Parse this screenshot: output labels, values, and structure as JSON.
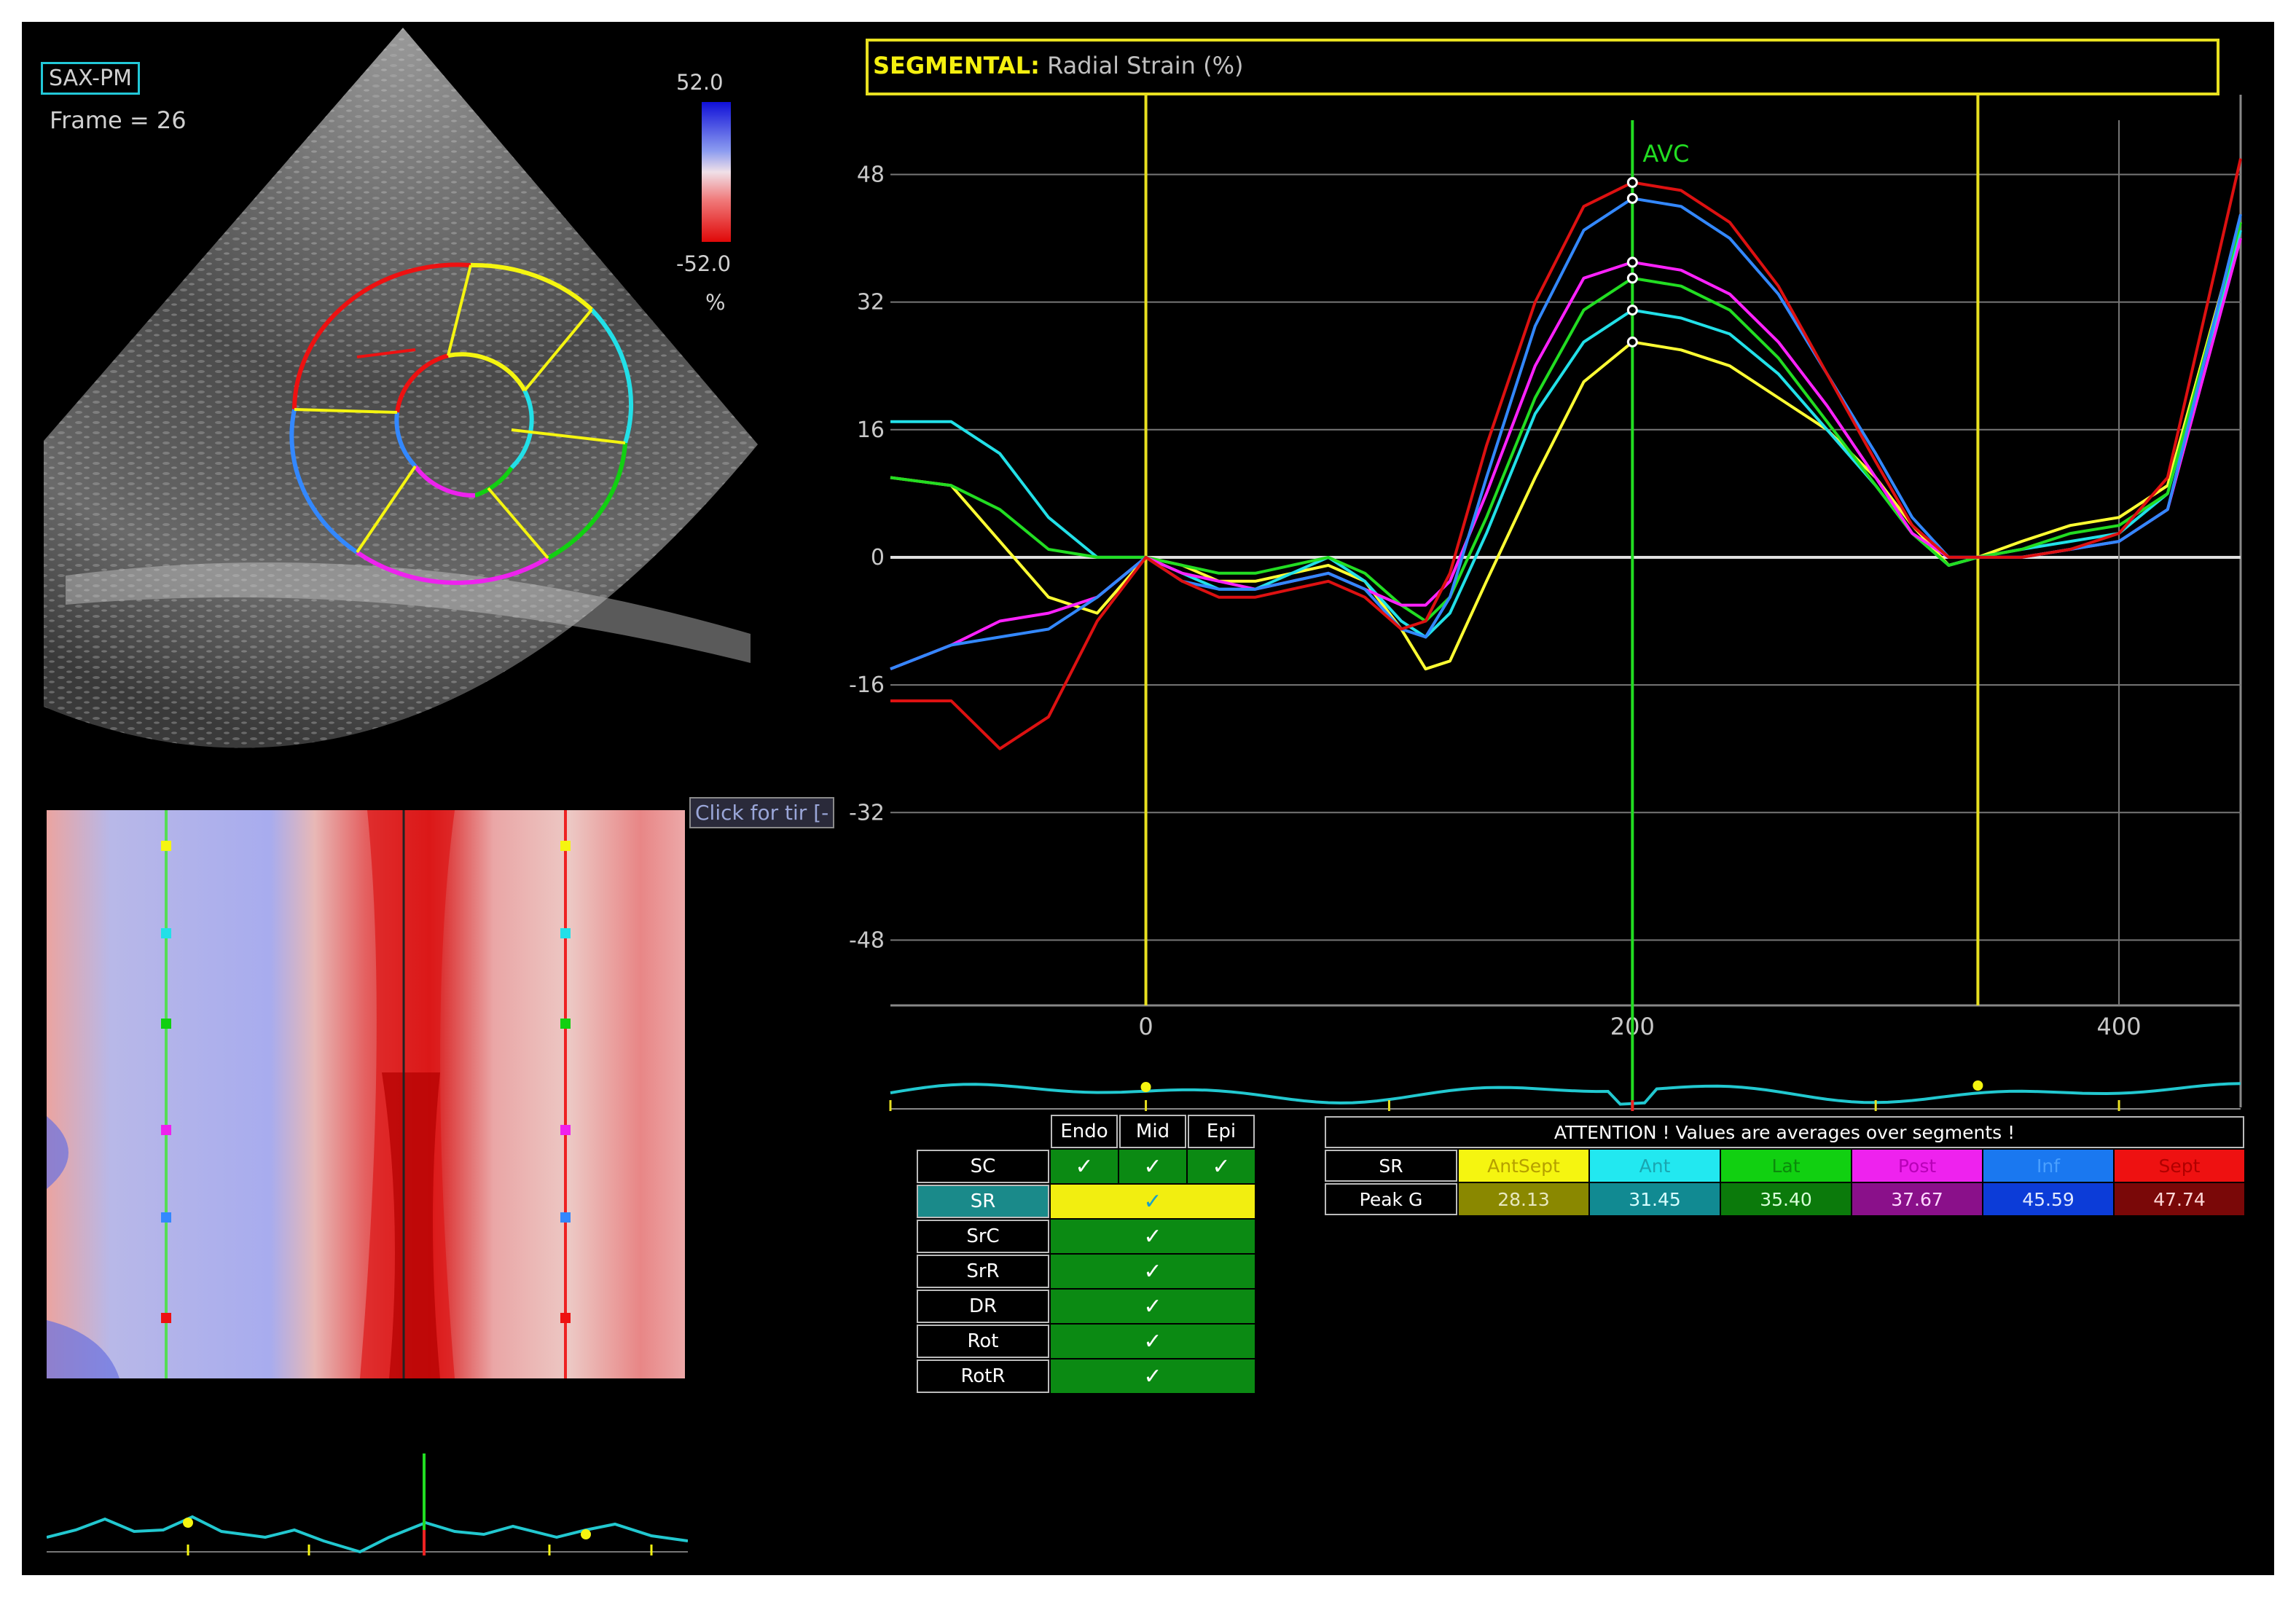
{
  "image_panel": {
    "view_label": "SAX-PM",
    "frame_text": "Frame = 26",
    "scale_max": "52.0",
    "scale_min": "-52.0",
    "scale_unit": "%"
  },
  "tooltip": "Click for tir [-",
  "chart_data": {
    "type": "line",
    "title_prefix": "SEGMENTAL:",
    "title": "Radial Strain (%)",
    "xlim": [
      -105,
      450
    ],
    "ylim": [
      -56,
      58
    ],
    "yticks": [
      48,
      32,
      16,
      0,
      -16,
      -32,
      -48
    ],
    "xticks": [
      0,
      200,
      400
    ],
    "marker_label": "AVC",
    "marker_x": 200,
    "event_lines_x": [
      0,
      342
    ],
    "x": [
      -105,
      -80,
      -60,
      -40,
      -20,
      0,
      15,
      30,
      45,
      60,
      75,
      90,
      105,
      115,
      125,
      140,
      160,
      180,
      200,
      220,
      240,
      260,
      280,
      300,
      315,
      330,
      342,
      360,
      380,
      400,
      420,
      450
    ],
    "series": [
      {
        "color": "#ffff33",
        "values": [
          10,
          9,
          2,
          -5,
          -7,
          0,
          -1,
          -3,
          -3,
          -2,
          -1,
          -3,
          -9,
          -14,
          -13,
          -3,
          10,
          22,
          27,
          26,
          24,
          20,
          16,
          10,
          4,
          -1,
          0,
          2,
          4,
          5,
          9,
          42
        ]
      },
      {
        "color": "#22e0e8",
        "values": [
          17,
          17,
          13,
          5,
          0,
          0,
          -2,
          -4,
          -4,
          -2,
          0,
          -3,
          -8,
          -10,
          -7,
          3,
          18,
          27,
          31,
          30,
          28,
          23,
          16,
          9,
          3,
          -1,
          0,
          1,
          2,
          3,
          8,
          41
        ]
      },
      {
        "color": "#22dd22",
        "values": [
          10,
          9,
          6,
          1,
          0,
          0,
          -1,
          -2,
          -2,
          -1,
          0,
          -2,
          -6,
          -8,
          -5,
          5,
          20,
          31,
          35,
          34,
          31,
          25,
          17,
          9,
          3,
          -1,
          0,
          1,
          3,
          4,
          8,
          42
        ]
      },
      {
        "color": "#ff22ff",
        "values": [
          -14,
          -11,
          -8,
          -7,
          -5,
          0,
          -2,
          -3,
          -4,
          -3,
          -2,
          -4,
          -6,
          -6,
          -3,
          8,
          24,
          35,
          37,
          36,
          33,
          27,
          19,
          10,
          3,
          0,
          0,
          0,
          1,
          2,
          6,
          40
        ]
      },
      {
        "color": "#3388ff",
        "values": [
          -14,
          -11,
          -10,
          -9,
          -5,
          0,
          -3,
          -4,
          -4,
          -3,
          -2,
          -4,
          -9,
          -10,
          -5,
          10,
          29,
          41,
          45,
          44,
          40,
          33,
          23,
          13,
          5,
          0,
          0,
          0,
          1,
          2,
          6,
          43
        ]
      },
      {
        "color": "#dd1111",
        "values": [
          -18,
          -18,
          -24,
          -20,
          -8,
          0,
          -3,
          -5,
          -5,
          -4,
          -3,
          -5,
          -9,
          -8,
          -2,
          14,
          32,
          44,
          47,
          46,
          42,
          34,
          23,
          12,
          4,
          0,
          0,
          0,
          1,
          3,
          10,
          50
        ]
      }
    ]
  },
  "mode_table": {
    "columns": [
      "Endo",
      "Mid",
      "Epi"
    ],
    "rows": [
      "SC",
      "SR",
      "SrC",
      "SrR",
      "DR",
      "Rot",
      "RotR"
    ],
    "selected_row": "SR",
    "check_glyph": "✓"
  },
  "attention_table": {
    "header": "ATTENTION !  Values are averages over segments !",
    "row_label_1": "SR",
    "row_label_2": "Peak G",
    "segments": [
      {
        "name": "AntSept",
        "value": "28.13",
        "bg": "#f5f510",
        "fg": "#b5a000",
        "vbg": "#8a8800",
        "vfg": "#e8e8c0"
      },
      {
        "name": "Ant",
        "value": "31.45",
        "bg": "#22e8f0",
        "fg": "#1aa6b0",
        "vbg": "#118a92",
        "vfg": "#d8ffff"
      },
      {
        "name": "Lat",
        "value": "35.40",
        "bg": "#11d011",
        "fg": "#0b8a0b",
        "vbg": "#0b7a0b",
        "vfg": "#d8ffd8"
      },
      {
        "name": "Post",
        "value": "37.67",
        "bg": "#ee22ee",
        "fg": "#b800b8",
        "vbg": "#8a108a",
        "vfg": "#ffd8ff"
      },
      {
        "name": "Inf",
        "value": "45.59",
        "bg": "#1a78f0",
        "fg": "#4aa0ff",
        "vbg": "#0c3cd8",
        "vfg": "#e0e8ff"
      },
      {
        "name": "Sept",
        "value": "47.74",
        "bg": "#ee1111",
        "fg": "#b00000",
        "vbg": "#7a0808",
        "vfg": "#ffd8d8"
      }
    ]
  }
}
